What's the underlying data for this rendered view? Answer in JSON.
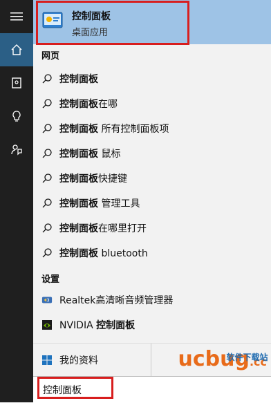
{
  "top_result": {
    "title": "控制面板",
    "subtitle": "桌面应用"
  },
  "sections": {
    "web": "网页",
    "settings": "设置"
  },
  "web_results": [
    {
      "bold": "控制面板",
      "rest": ""
    },
    {
      "bold": "控制面板",
      "rest": "在哪"
    },
    {
      "bold": "控制面板",
      "rest": " 所有控制面板项"
    },
    {
      "bold": "控制面板",
      "rest": " 鼠标"
    },
    {
      "bold": "控制面板",
      "rest": "快捷键"
    },
    {
      "bold": "控制面板",
      "rest": " 管理工具"
    },
    {
      "bold": "控制面板",
      "rest": "在哪里打开"
    },
    {
      "bold": "控制面板",
      "rest": " bluetooth"
    }
  ],
  "settings_results": [
    {
      "text": "Realtek高清晰音频管理器"
    },
    {
      "text_plain": "NVIDIA ",
      "text_bold": "控制面板"
    }
  ],
  "bottom": {
    "my_stuff": "我的资料"
  },
  "search": {
    "value": "控制面板"
  },
  "watermark": {
    "main": "ucbug",
    "sub": "软件下载站",
    "tld": ".cc"
  },
  "colors": {
    "accent": "#2b5f86",
    "highlight_border": "#d81e1e",
    "selected_bg": "#9ec3e6"
  }
}
